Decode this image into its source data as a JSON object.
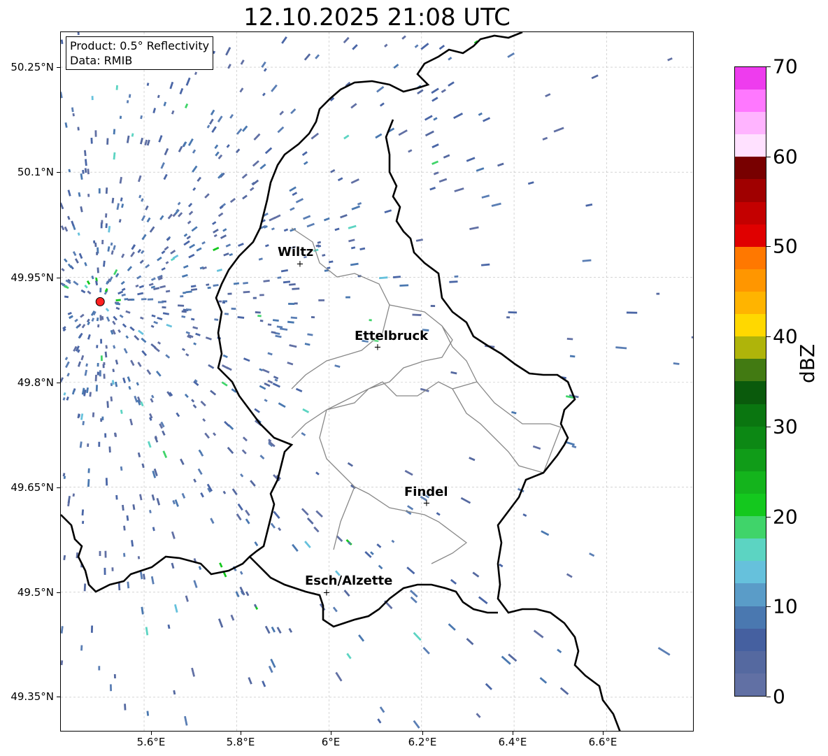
{
  "title": "12.10.2025 21:08 UTC",
  "info": {
    "product": "Product: 0.5° Reflectivity",
    "data": "Data: RMIB"
  },
  "y_ticks": [
    "50.25°N",
    "50.1°N",
    "49.95°N",
    "49.8°N",
    "49.65°N",
    "49.5°N",
    "49.35°N"
  ],
  "x_ticks": [
    "5.6°E",
    "5.8°E",
    "6°E",
    "6.2°E",
    "6.4°E",
    "6.6°E"
  ],
  "cities": [
    {
      "name": "Wiltz",
      "lon": 5.93,
      "lat": 49.97
    },
    {
      "name": "Ettelbruck",
      "lon": 6.1,
      "lat": 49.85
    },
    {
      "name": "Findel",
      "lon": 6.21,
      "lat": 49.63
    },
    {
      "name": "Esch/Alzette",
      "lon": 5.98,
      "lat": 49.5
    }
  ],
  "radar_site": {
    "lon": 5.505,
    "lat": 49.915,
    "color": "#ff2020"
  },
  "extent": {
    "lon_min": 5.42,
    "lon_max": 6.79,
    "lat_min": 49.3,
    "lat_max": 50.3
  },
  "colorbar": {
    "label": "dBZ",
    "min": 0,
    "max": 70,
    "step": 2.5,
    "tick_labels": [
      "0",
      "10",
      "20",
      "30",
      "40",
      "50",
      "60",
      "70"
    ],
    "colors": [
      "#6170a4",
      "#5569a0",
      "#4560a0",
      "#4a78b0",
      "#5a9cc8",
      "#66c1dc",
      "#5cd4c2",
      "#40d46a",
      "#14c81e",
      "#14b41c",
      "#109c18",
      "#0c8814",
      "#0a7610",
      "#0a5a0c",
      "#427a12",
      "#afb40a",
      "#ffd800",
      "#ffb400",
      "#ff9600",
      "#ff7800",
      "#e00000",
      "#c40000",
      "#a00000",
      "#780000",
      "#ffe1ff",
      "#ffb4ff",
      "#ff78ff",
      "#ee3cee"
    ]
  }
}
